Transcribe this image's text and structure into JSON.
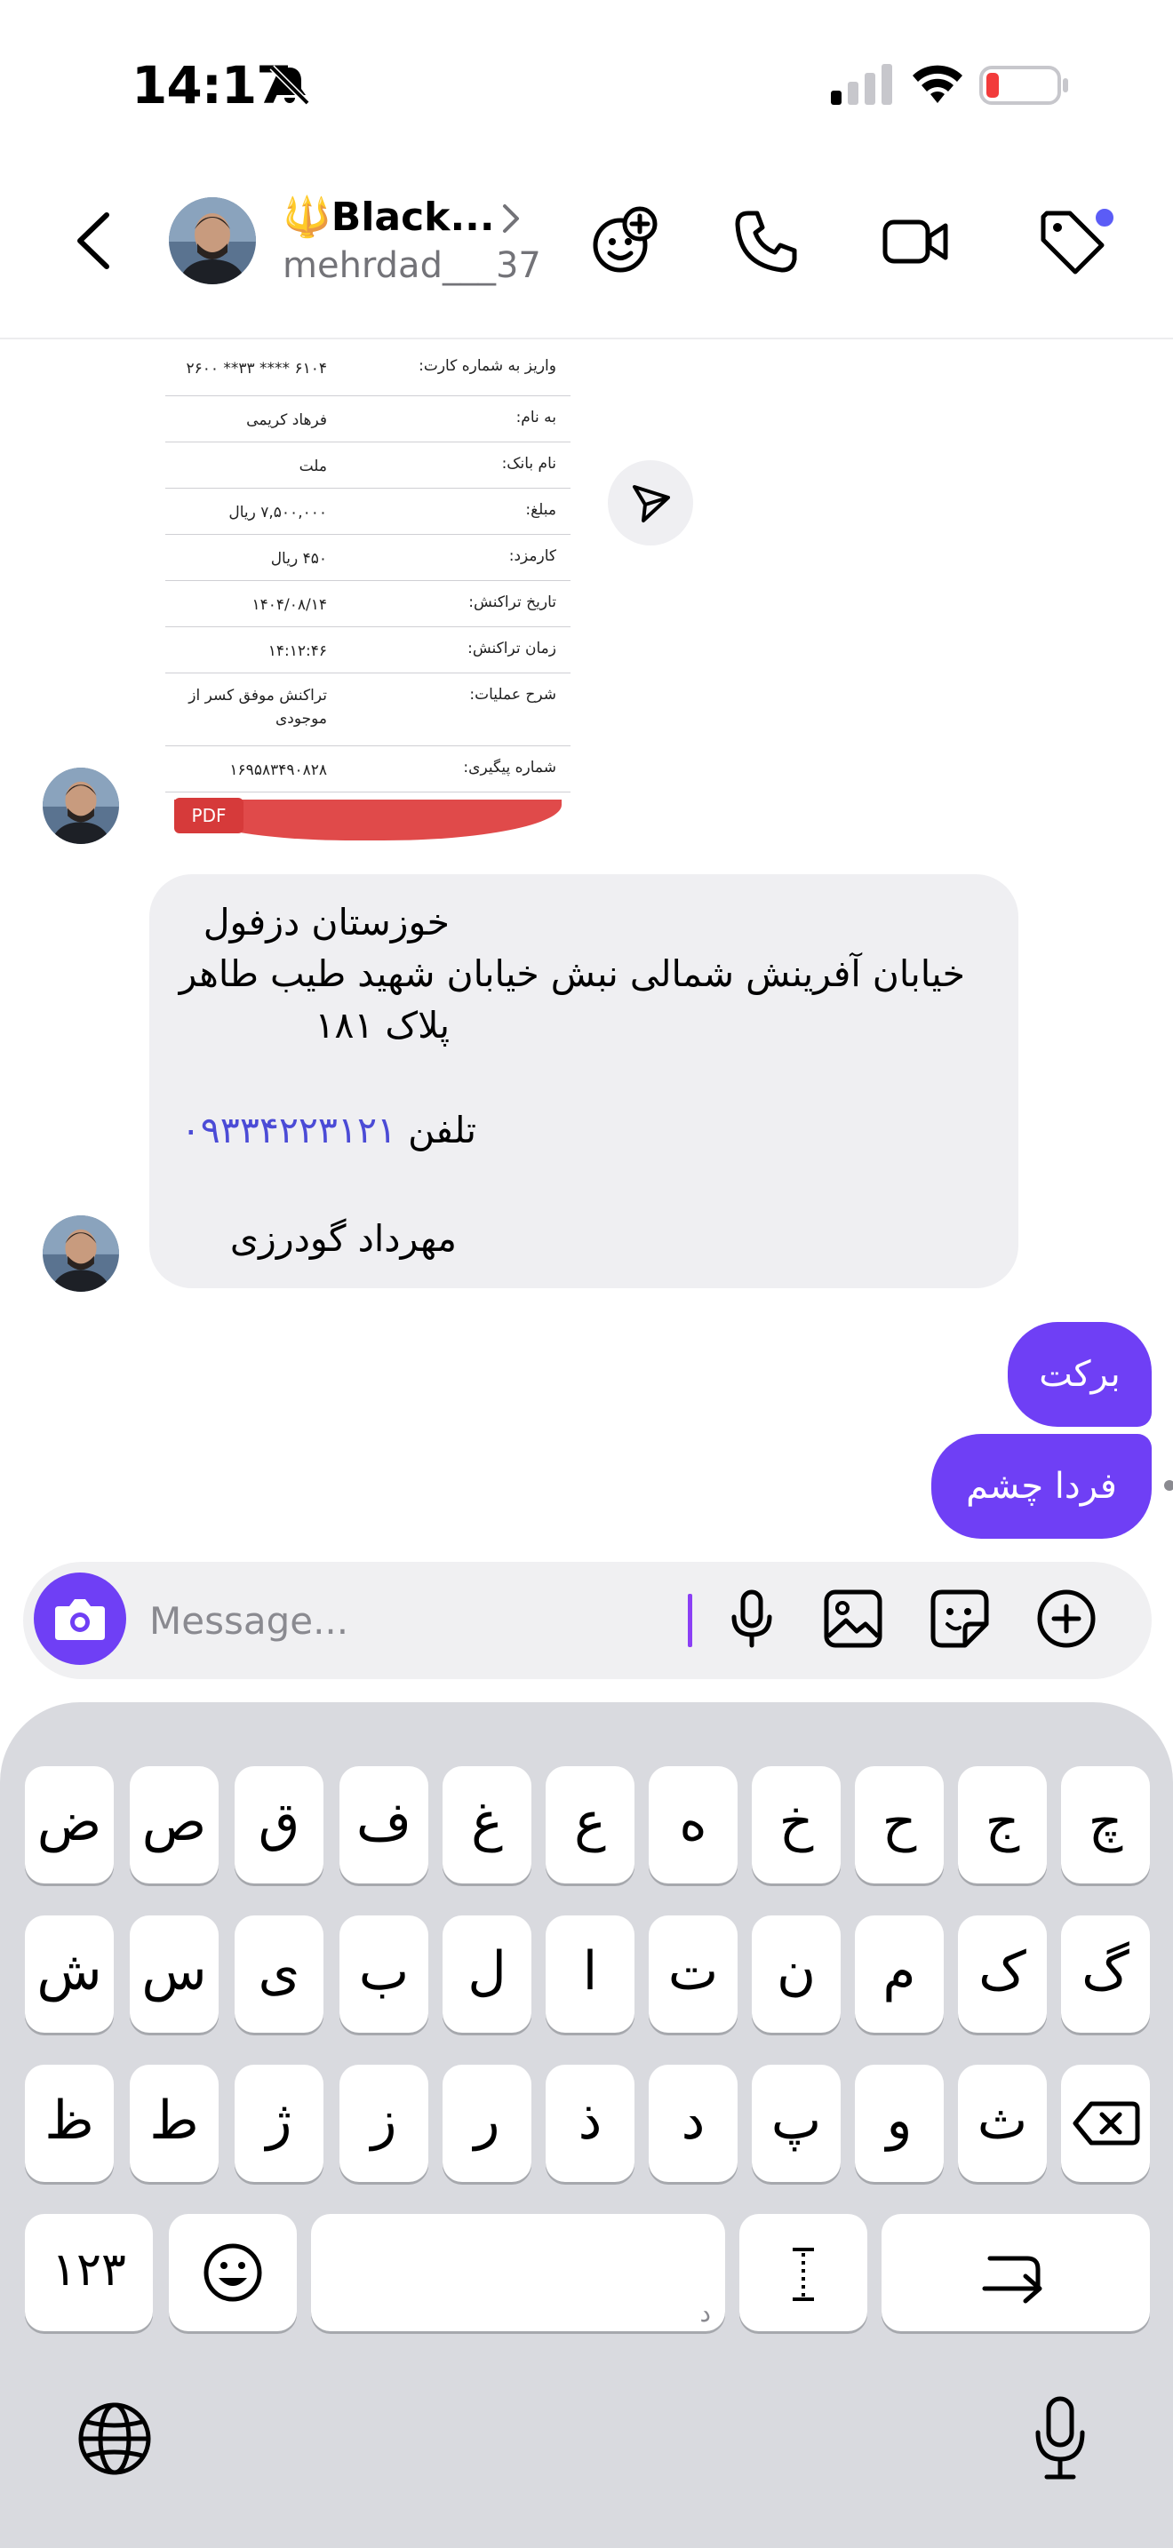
{
  "status_bar": {
    "time": "14:17"
  },
  "header": {
    "contact_name": "🔱Black...",
    "contact_handle": "mehrdad___37"
  },
  "receipt": {
    "rows": [
      {
        "label": "واریز به شماره کارت:",
        "value": "۶۱۰۴ **** ۳۳** ۲۶۰۰"
      },
      {
        "label": "به نام:",
        "value": "فرهاد کریمی"
      },
      {
        "label": "نام بانک:",
        "value": "ملت"
      },
      {
        "label": "مبلغ:",
        "value": "۷,۵۰۰,۰۰۰ ریال"
      },
      {
        "label": "کارمزد:",
        "value": "۴۵۰ ریال"
      },
      {
        "label": "تاریخ تراکنش:",
        "value": "۱۴۰۴/۰۸/۱۴"
      },
      {
        "label": "زمان تراکنش:",
        "value": "۱۴:۱۲:۴۶"
      },
      {
        "label": "شرح عملیات:",
        "value": "تراکنش موفق کسر از موجودی"
      },
      {
        "label": "شماره پیگیری:",
        "value": "۱۶۹۵۸۳۴۹۰۸۲۸"
      }
    ],
    "badge": "PDF"
  },
  "message_in": {
    "line1": "خوزستان دزفول",
    "line2": "خیابان آفرینش شمالی نبش خیابان شهید طیب طاهر",
    "line3": "پلاک ۱۸۱",
    "phone_label": "تلفن",
    "phone_number": "۰۹۳۳۴۲۲۳۱۲۱",
    "signature": "مهرداد گودرزی"
  },
  "messages_out": [
    {
      "text": "برکت"
    },
    {
      "text": "فردا چشم"
    }
  ],
  "composer": {
    "placeholder": "Message..."
  },
  "keyboard": {
    "row1": [
      "ض",
      "ص",
      "ق",
      "ف",
      "غ",
      "ع",
      "ه",
      "خ",
      "ح",
      "ج",
      "چ"
    ],
    "row2": [
      "ش",
      "س",
      "ی",
      "ب",
      "ل",
      "ا",
      "ت",
      "ن",
      "م",
      "ک",
      "گ"
    ],
    "row3": [
      "ظ",
      "ط",
      "ژ",
      "ز",
      "ر",
      "ذ",
      "د",
      "پ",
      "و",
      "ث"
    ],
    "numbers_key": "۱۲۳",
    "space_hint": "د"
  }
}
